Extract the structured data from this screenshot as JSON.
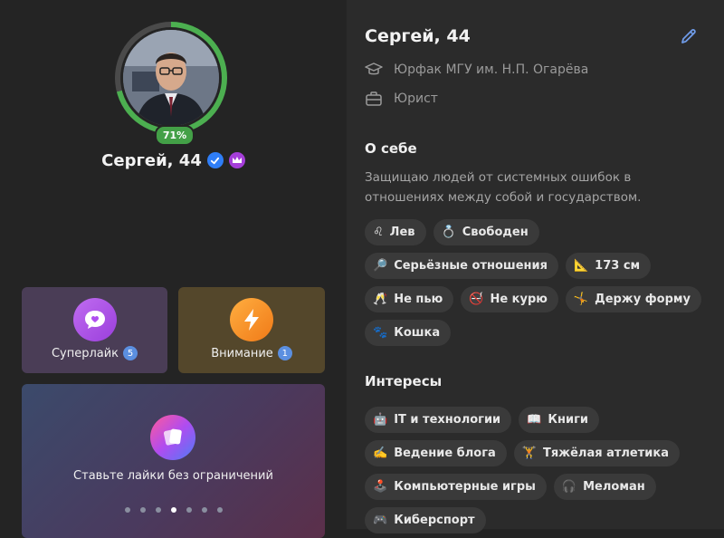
{
  "profile": {
    "name_age": "Сергей, 44",
    "completion": "71%",
    "completion_value": 0.71
  },
  "cards": {
    "superlike": {
      "label": "Суперлайк",
      "count": "5"
    },
    "attention": {
      "label": "Внимание",
      "count": "1"
    },
    "unlimited": {
      "text": "Ставьте лайки без ограничений",
      "dots_total": 7,
      "active_dot": 4
    }
  },
  "details": {
    "name_age": "Сергей, 44",
    "education": "Юрфак МГУ им. Н.П. Огарёва",
    "job": "Юрист"
  },
  "about": {
    "title": "О себе",
    "text": "Защищаю людей от системных ошибок в отношениях между собой и государством."
  },
  "traits": [
    {
      "icon": "♌",
      "label": "Лев"
    },
    {
      "icon": "💍",
      "label": "Свободен"
    },
    {
      "icon": "🔎",
      "label": "Серьёзные отношения"
    },
    {
      "icon": "📐",
      "label": "173 см"
    },
    {
      "icon": "🥂",
      "label": "Не пью"
    },
    {
      "icon": "🚭",
      "label": "Не курю"
    },
    {
      "icon": "🤸",
      "label": "Держу форму"
    },
    {
      "icon": "🐾",
      "label": "Кошка"
    }
  ],
  "interests": {
    "title": "Интересы",
    "items": [
      {
        "icon": "🤖",
        "label": "IT и технологии"
      },
      {
        "icon": "📖",
        "label": "Книги"
      },
      {
        "icon": "✍️",
        "label": "Ведение блога"
      },
      {
        "icon": "🏋️",
        "label": "Тяжёлая атлетика"
      },
      {
        "icon": "🕹️",
        "label": "Компьютерные игры"
      },
      {
        "icon": "🎧",
        "label": "Меломан"
      },
      {
        "icon": "🎮",
        "label": "Киберспорт"
      }
    ]
  },
  "colors": {
    "progress": "#4caf50",
    "verified": "#2f7ef7",
    "premium": "#a53ed9",
    "accent_link": "#6f9be8"
  }
}
